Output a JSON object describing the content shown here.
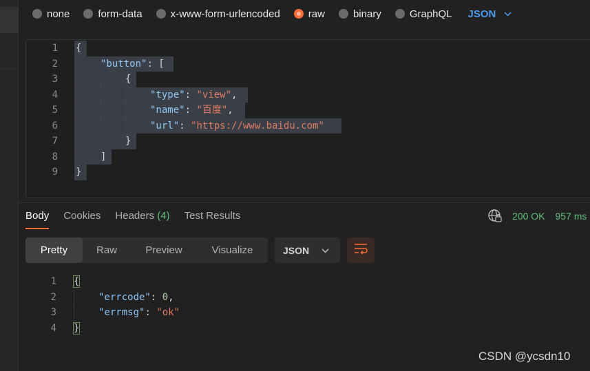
{
  "body_type": {
    "options": [
      {
        "label": "none",
        "checked": false
      },
      {
        "label": "form-data",
        "checked": false
      },
      {
        "label": "x-www-form-urlencoded",
        "checked": false
      },
      {
        "label": "raw",
        "checked": true
      },
      {
        "label": "binary",
        "checked": false
      },
      {
        "label": "GraphQL",
        "checked": false
      }
    ],
    "format": "JSON"
  },
  "request_body": {
    "line_numbers": [
      "1",
      "2",
      "3",
      "4",
      "5",
      "6",
      "7",
      "8",
      "9"
    ],
    "lines": [
      {
        "parts": [
          {
            "t": "{",
            "c": "p"
          }
        ]
      },
      {
        "parts": [
          {
            "t": "\"button\"",
            "c": "k"
          },
          {
            "t": ": [",
            "c": "p"
          }
        ]
      },
      {
        "parts": [
          {
            "t": "{",
            "c": "p"
          }
        ]
      },
      {
        "parts": [
          {
            "t": "\"type\"",
            "c": "k"
          },
          {
            "t": ": ",
            "c": "p"
          },
          {
            "t": "\"view\"",
            "c": "s"
          },
          {
            "t": ",",
            "c": "p"
          }
        ]
      },
      {
        "parts": [
          {
            "t": "\"name\"",
            "c": "k"
          },
          {
            "t": ": ",
            "c": "p"
          },
          {
            "t": "\"百度\"",
            "c": "s"
          },
          {
            "t": ",",
            "c": "p"
          }
        ]
      },
      {
        "parts": [
          {
            "t": "\"url\"",
            "c": "k"
          },
          {
            "t": ": ",
            "c": "p"
          },
          {
            "t": "\"https://www.baidu.com\"",
            "c": "s"
          }
        ]
      },
      {
        "parts": [
          {
            "t": "}",
            "c": "p"
          }
        ]
      },
      {
        "parts": [
          {
            "t": "]",
            "c": "p"
          }
        ]
      },
      {
        "parts": [
          {
            "t": "}",
            "c": "p"
          }
        ]
      }
    ]
  },
  "response_tabs": {
    "body": "Body",
    "cookies": "Cookies",
    "headers": "Headers",
    "headers_count": "(4)",
    "test_results": "Test Results"
  },
  "status": {
    "code": "200 OK",
    "time": "957 ms",
    "globe_icon": "globe-icon"
  },
  "view_modes": {
    "pretty": "Pretty",
    "raw": "Raw",
    "preview": "Preview",
    "visualize": "Visualize"
  },
  "response_format": "JSON",
  "response_body": {
    "line_numbers": [
      "1",
      "2",
      "3",
      "4"
    ],
    "lines": [
      {
        "parts": [
          {
            "t": "{",
            "c": "p"
          }
        ]
      },
      {
        "parts": [
          {
            "t": "\"errcode\"",
            "c": "k"
          },
          {
            "t": ": ",
            "c": "p"
          },
          {
            "t": "0",
            "c": "n"
          },
          {
            "t": ",",
            "c": "p"
          }
        ]
      },
      {
        "parts": [
          {
            "t": "\"errmsg\"",
            "c": "k"
          },
          {
            "t": ": ",
            "c": "p"
          },
          {
            "t": "\"ok\"",
            "c": "s"
          }
        ]
      },
      {
        "parts": [
          {
            "t": "}",
            "c": "p"
          }
        ]
      }
    ]
  },
  "watermark": "CSDN @ycsdn10",
  "colors": {
    "accent": "#ff6c37",
    "json_blue": "#4a9bf0",
    "status_green": "#5fc17a"
  }
}
